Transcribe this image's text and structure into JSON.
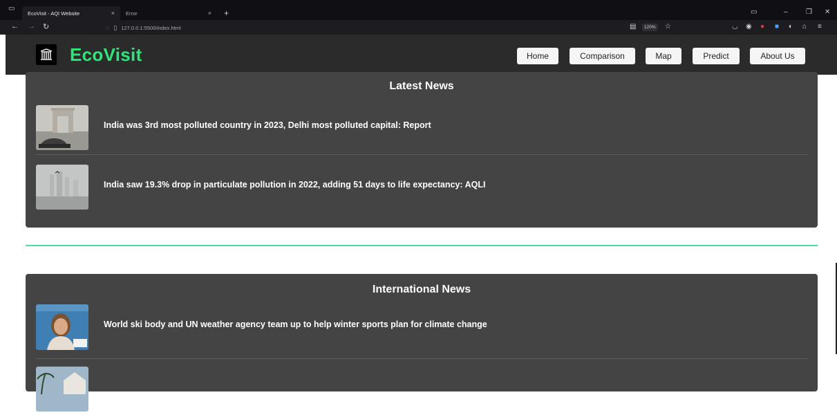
{
  "browser": {
    "tabs": [
      {
        "title": "EcoVisit - AQI Website",
        "close": "×"
      },
      {
        "title": "Error",
        "close": "×"
      }
    ],
    "new_tab": "+",
    "url": "127.0.0.1:5500/index.html",
    "zoom": "120%"
  },
  "site": {
    "brand": "EcoVisit",
    "nav": [
      "Home",
      "Comparison",
      "Map",
      "Predict",
      "About Us"
    ]
  },
  "latest_news": {
    "title": "Latest News",
    "items": [
      {
        "headline": "India was 3rd most polluted country in 2023, Delhi most polluted capital: Report"
      },
      {
        "headline": "India saw 19.3% drop in particulate pollution in 2022, adding 51 days to life expectancy: AQLI"
      }
    ]
  },
  "international_news": {
    "title": "International News",
    "items": [
      {
        "headline": "World ski body and UN weather agency team up to help winter sports plan for climate change"
      },
      {
        "headline": ""
      }
    ]
  },
  "colors": {
    "brand": "#2ee57a",
    "card_bg": "#444444",
    "header_bg": "#2b2b2b",
    "divider": "#4ade9a"
  }
}
